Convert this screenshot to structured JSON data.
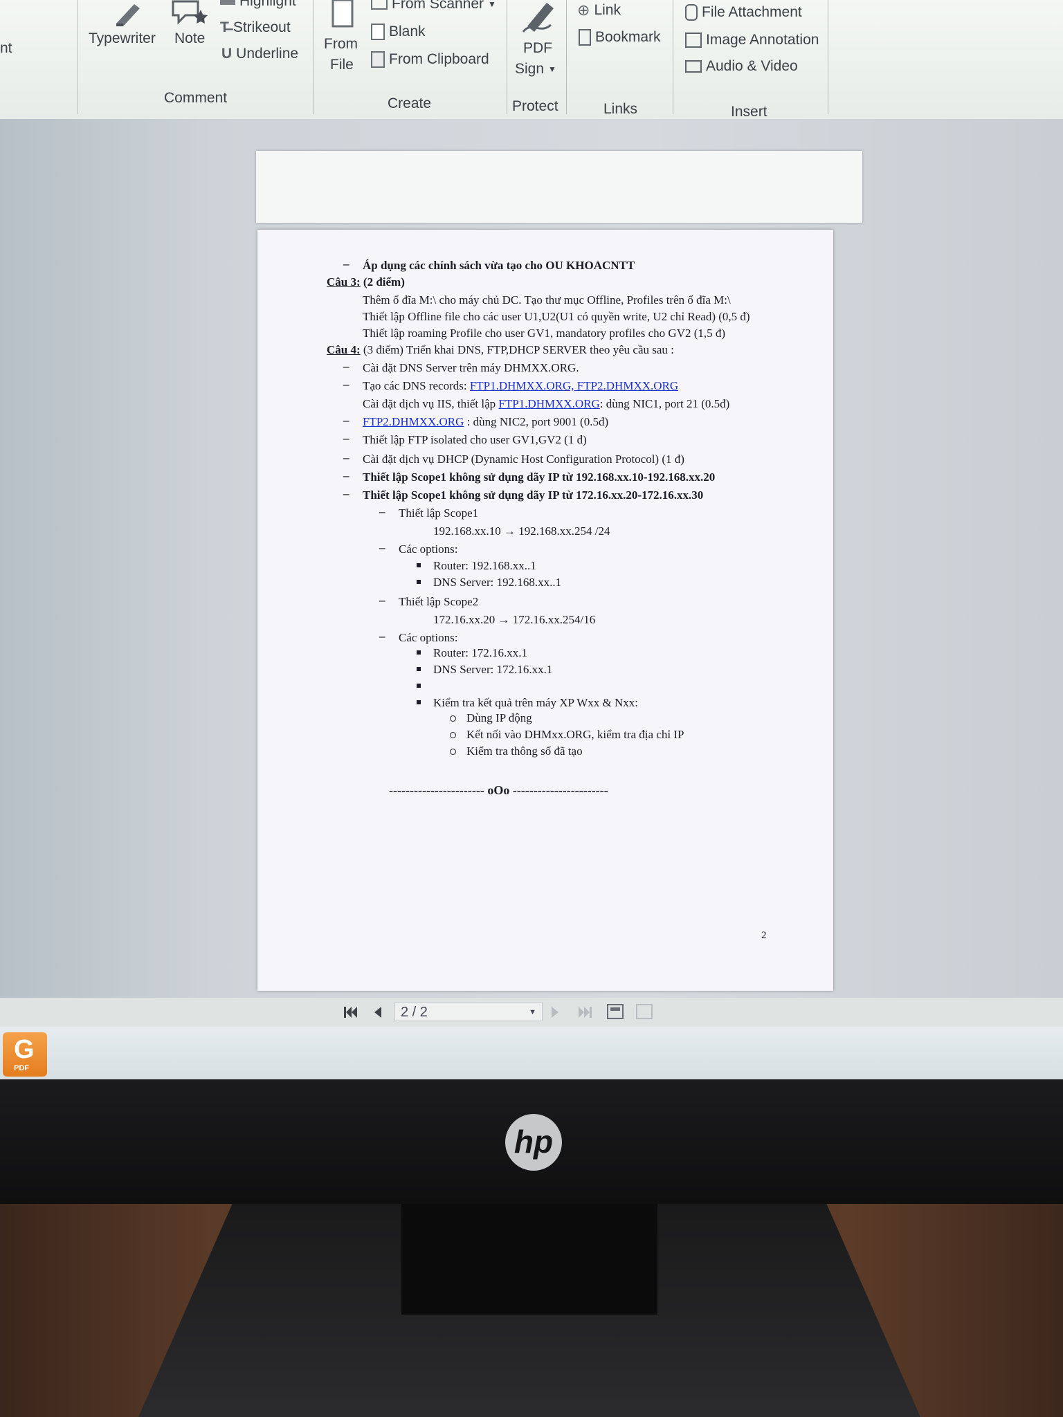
{
  "ribbon": {
    "left_cut_text": "nt",
    "comment": {
      "label": "Comment",
      "typewriter": "Typewriter",
      "note": "Note",
      "highlight": "Highlight",
      "strikeout": "Strikeout",
      "underline": "Underline"
    },
    "create": {
      "label": "Create",
      "from_file_1": "From",
      "from_file_2": "File",
      "from_scanner": "From Scanner",
      "blank": "Blank",
      "from_clipboard": "From Clipboard"
    },
    "protect": {
      "label": "Protect",
      "pdf_sign_1": "PDF",
      "pdf_sign_2": "Sign"
    },
    "links": {
      "label": "Links",
      "link": "Link",
      "bookmark": "Bookmark"
    },
    "insert": {
      "label": "Insert",
      "file_attachment": "File Attachment",
      "image_annotation": "Image Annotation",
      "audio_video": "Audio & Video"
    }
  },
  "document": {
    "line1": "Áp dụng các chính sách vừa tạo cho OU KHOACNTT",
    "cau3_label": "Câu 3:",
    "cau3_rest": " (2 điểm)",
    "cau3_a": "Thêm ổ đĩa M:\\ cho máy chủ DC. Tạo thư mục Offline, Profiles trên ổ đĩa M:\\",
    "cau3_b": "Thiết lập Offline file cho các user U1,U2(U1 có quyền write, U2 chỉ Read) (0,5 đ)",
    "cau3_c": "Thiết lập roaming Profile cho user GV1,  mandatory profiles cho GV2 (1,5 đ)",
    "cau4_label": "Câu 4:",
    "cau4_rest": " (3 điểm) Triển khai DNS, FTP,DHCP SERVER theo yêu cầu sau :",
    "c4_1": "Cài đặt DNS Server trên máy DHMXX.ORG.",
    "c4_2_pre": "Tạo các DNS records: ",
    "c4_2_link": "FTP1.DHMXX.ORG, FTP2.DHMXX.ORG",
    "c4_3_pre": "Cài đặt dịch vụ IIS, thiết lập ",
    "c4_3_link": "FTP1.DHMXX.ORG",
    "c4_3_post": ": dùng NIC1, port 21 (0.5đ)",
    "c4_4_link": "FTP2.DHMXX.ORG",
    "c4_4_post": " : dùng NIC2, port 9001 (0.5đ)",
    "c4_5": "Thiết lập FTP isolated cho user GV1,GV2 (1 đ)",
    "c4_6": "Cài đặt dịch vụ DHCP (Dynamic Host Configuration Protocol) (1 đ)",
    "c4_7": "Thiết lập Scope1 không sử dụng dãy IP từ 192.168.xx.10-192.168.xx.20",
    "c4_8": "Thiết lập Scope1 không sử dụng dãy IP từ 172.16.xx.20-172.16.xx.30",
    "s1_title": "Thiết lập Scope1",
    "s1_range": "192.168.xx.10 → 192.168.xx.254 /24",
    "opt1_title": "Các options:",
    "opt1_router": "Router: 192.168.xx..1",
    "opt1_dns": "DNS Server: 192.168.xx..1",
    "s2_title": "Thiết lập Scope2",
    "s2_range": "172.16.xx.20 → 172.16.xx.254/16",
    "opt2_title": "Các options:",
    "opt2_router": "Router: 172.16.xx.1",
    "opt2_dns": "DNS Server: 172.16.xx.1",
    "check": "Kiểm tra kết quả trên máy XP Wxx & Nxx:",
    "check_1": "Dùng IP động",
    "check_2": "Kết nối vào DHMxx.ORG, kiểm tra địa chỉ IP",
    "check_3": "Kiểm tra thông số đã tạo",
    "end_mark": "----------------------- oOo -----------------------",
    "page_number": "2"
  },
  "navigation": {
    "page_indicator": "2 / 2"
  },
  "taskbar": {
    "app_label": "PDF"
  },
  "monitor": {
    "brand": "hp"
  }
}
